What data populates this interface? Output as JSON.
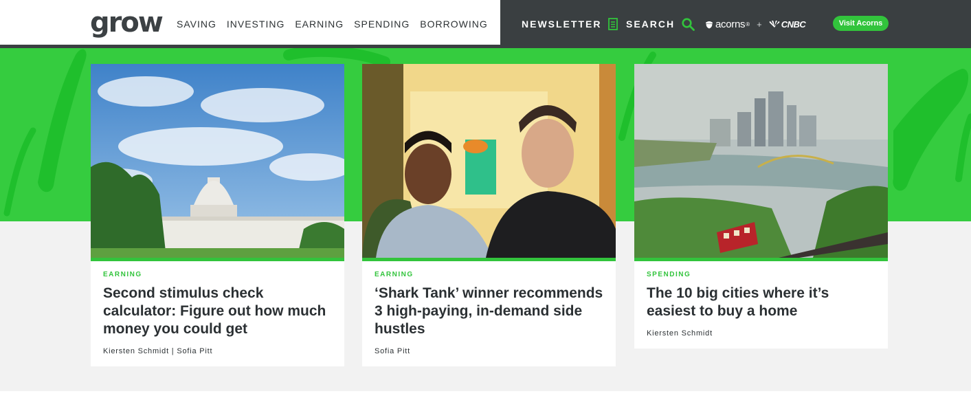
{
  "header": {
    "logo": "grow",
    "nav": [
      "SAVING",
      "INVESTING",
      "EARNING",
      "SPENDING",
      "BORROWING"
    ],
    "newsletter_label": "NEWSLETTER",
    "search_label": "SEARCH",
    "partner_acorns": "acorns",
    "partner_acorns_mark": "®",
    "partner_plus": "+",
    "partner_cnbc": "CNBC",
    "visit_button": "Visit Acorns"
  },
  "colors": {
    "brand_green": "#32c43c",
    "header_dark": "#3a3f41",
    "text_dark": "#2b3033"
  },
  "icons": {
    "newsletter": "document-icon",
    "search": "search-icon",
    "acorns": "acorn-icon",
    "cnbc": "peacock-icon"
  },
  "cards": [
    {
      "category": "EARNING",
      "title": "Second stimulus check calculator: Figure out how much money you could get",
      "author": "Kiersten Schmidt | Sofia Pitt",
      "image": "capitol-building-photo"
    },
    {
      "category": "EARNING",
      "title": "‘Shark Tank’ winner recommends 3 high-paying, in-demand side hustles",
      "author": "Sofia Pitt",
      "image": "two-men-portrait-photo"
    },
    {
      "category": "SPENDING",
      "title": "The 10 big cities where it’s easiest to buy a home",
      "author": "Kiersten Schmidt",
      "image": "pittsburgh-skyline-photo"
    }
  ]
}
